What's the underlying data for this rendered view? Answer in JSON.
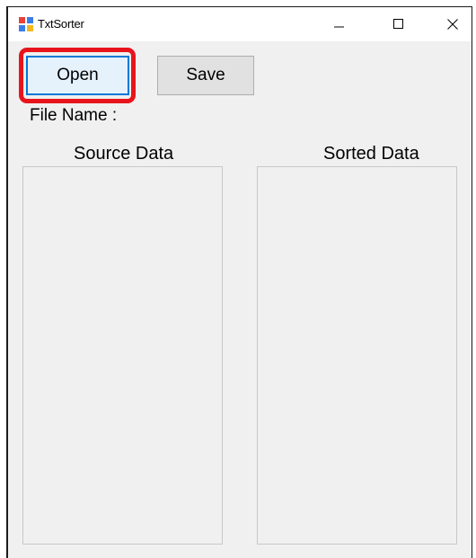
{
  "window": {
    "title": "TxtSorter",
    "icon": "app-icon",
    "controls": {
      "minimize_icon": "minimize-icon",
      "maximize_icon": "maximize-icon",
      "close_icon": "close-icon"
    }
  },
  "toolbar": {
    "open_label": "Open",
    "save_label": "Save"
  },
  "file_name_label": "File Name :",
  "panels": {
    "source_header": "Source Data",
    "sorted_header": "Sorted Data"
  },
  "colors": {
    "highlight": "#e8141c",
    "focus_border": "#0078d7",
    "window_bg": "#f0f0f0"
  }
}
